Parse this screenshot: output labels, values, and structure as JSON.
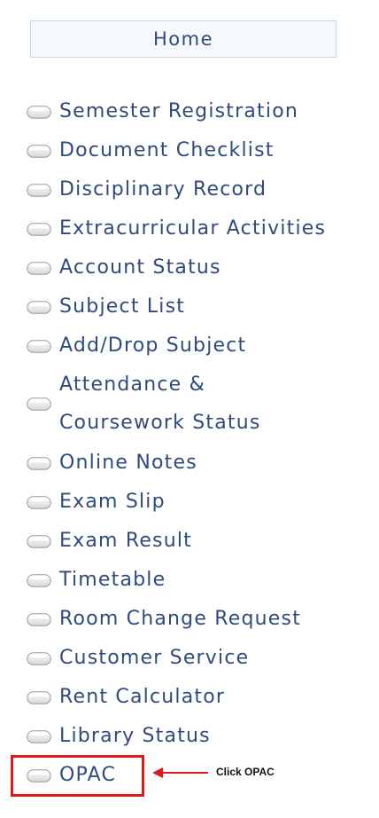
{
  "home": {
    "label": "Home"
  },
  "menu": {
    "items": [
      {
        "label": "Semester Registration"
      },
      {
        "label": "Document Checklist"
      },
      {
        "label": "Disciplinary Record"
      },
      {
        "label": "Extracurricular Activities"
      },
      {
        "label": "Account Status"
      },
      {
        "label": "Subject List"
      },
      {
        "label": "Add/Drop Subject"
      },
      {
        "line1": "Attendance &",
        "line2": "Coursework Status"
      },
      {
        "label": "Online Notes"
      },
      {
        "label": "Exam Slip"
      },
      {
        "label": "Exam Result"
      },
      {
        "label": "Timetable"
      },
      {
        "label": "Room Change Request"
      },
      {
        "label": "Customer Service"
      },
      {
        "label": "Rent Calculator"
      },
      {
        "label": "Library Status"
      },
      {
        "label": "OPAC"
      }
    ]
  },
  "annotation": {
    "text": "Click OPAC",
    "color": "#e01818"
  },
  "colors": {
    "link": "#2f4a7c",
    "home_bg": "#f5f8fd",
    "home_border": "#c7d5ea"
  }
}
